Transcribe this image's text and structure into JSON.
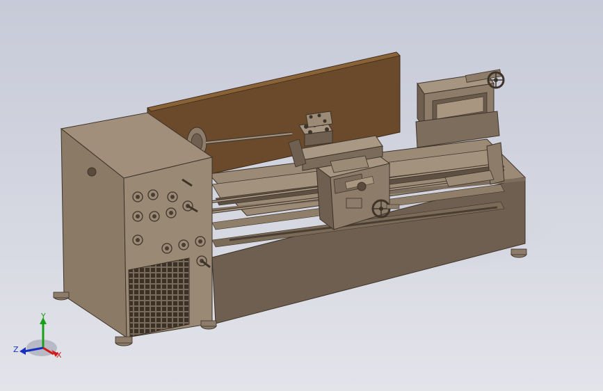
{
  "viewport": {
    "background_top": "#c7cad8",
    "background_bottom": "#e3e4ea",
    "model_color": "#8c7b68",
    "guard_color": "#6b4a2b"
  },
  "model": {
    "icon": "lathe-3d-model"
  },
  "triad": {
    "x_label": "X",
    "y_label": "Y",
    "z_label": "Z",
    "x_color": "#d01818",
    "y_color": "#18a018",
    "z_color": "#1830c0"
  }
}
